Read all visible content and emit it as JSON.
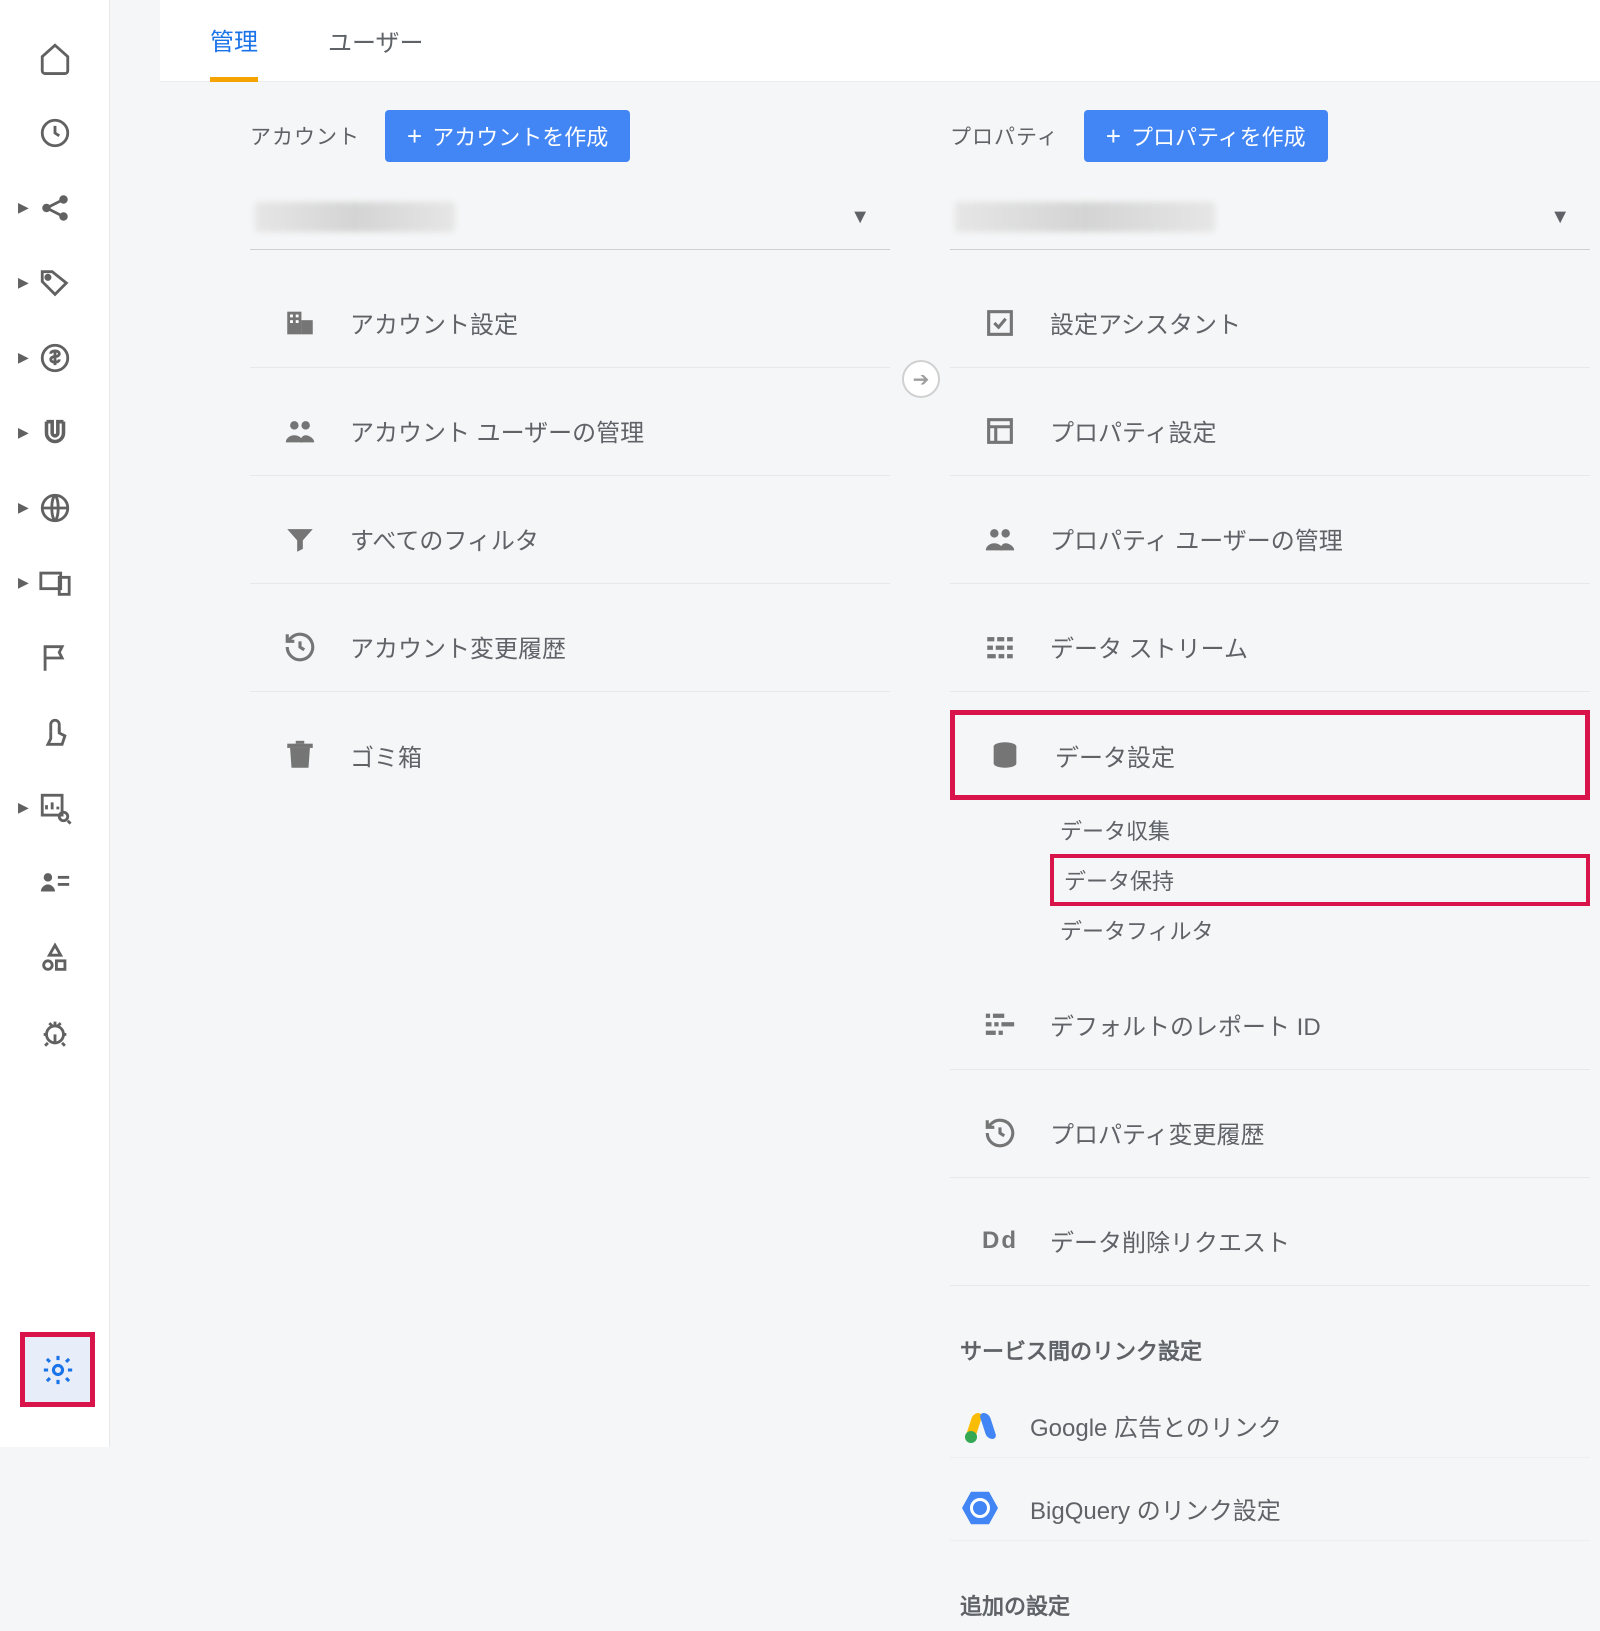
{
  "tabs": {
    "admin_label": "管理",
    "user_label": "ユーザー"
  },
  "account": {
    "col_label": "アカウント",
    "create_button_label": "アカウントを作成",
    "items": {
      "settings": "アカウント設定",
      "user_mgmt": "アカウント ユーザーの管理",
      "filters": "すべてのフィルタ",
      "history": "アカウント変更履歴",
      "trash": "ゴミ箱"
    }
  },
  "property": {
    "col_label": "プロパティ",
    "create_button_label": "プロパティを作成",
    "items": {
      "assistant": "設定アシスタント",
      "settings": "プロパティ設定",
      "user_mgmt": "プロパティ ユーザーの管理",
      "streams": "データ ストリーム",
      "data_settings": "データ設定",
      "sub_collection": "データ収集",
      "sub_retention": "データ保持",
      "sub_filter": "データフィルタ",
      "report_id": "デフォルトのレポート ID",
      "history": "プロパティ変更履歴",
      "delete_req": "データ削除リクエスト",
      "section_linking": "サービス間のリンク設定",
      "ads_link": "Google 広告とのリンク",
      "bq_link": "BigQuery のリンク設定",
      "section_additional": "追加の設定"
    }
  }
}
